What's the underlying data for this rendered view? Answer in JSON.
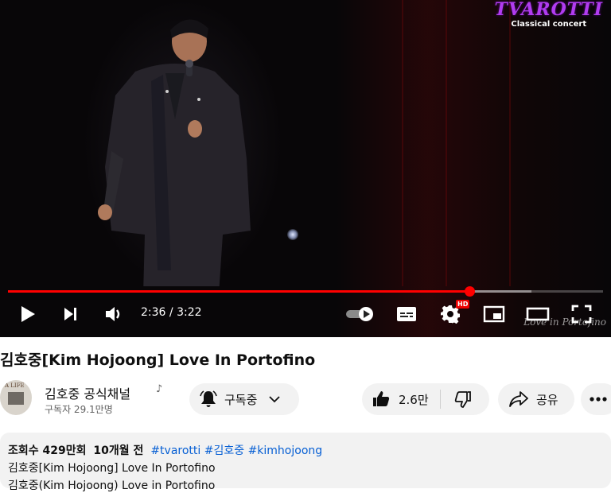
{
  "player": {
    "logo_text": "TVAROTTI",
    "logo_subtitle": "Classical concert",
    "watermark": "Love in Portofino",
    "progress_fraction": 0.775,
    "buffer_fraction": 0.88,
    "time_current": "2:36",
    "time_total": "3:22",
    "time_separator": " / ",
    "hd_badge": "HD",
    "accent_color": "#ff0000",
    "logo_color": "#b13cf0"
  },
  "video": {
    "title": "김호중[Kim Hojoong] Love In Portofino"
  },
  "channel": {
    "avatar_text": "A LIFE",
    "name": "김호중 공식채널",
    "subscribers": "구독자 29.1만명",
    "subscribe_label": "구독중"
  },
  "actions": {
    "like_count": "2.6만",
    "share_label": "공유"
  },
  "description": {
    "views": "조회수 429만회",
    "age": "10개월 전",
    "hashtags": [
      "#tvarotti",
      "#김호중",
      "#kimhojoong"
    ],
    "line1": "김호중[Kim Hojoong] Love In Portofino",
    "line2": "김호중(Kim Hojoong) Love in Portofino"
  }
}
